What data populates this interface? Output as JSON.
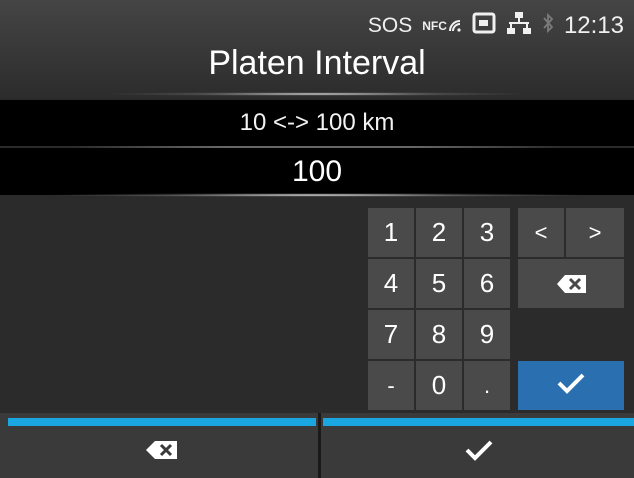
{
  "status": {
    "sos_text": "SOS",
    "nfc_text": "NFC",
    "time": "12:13",
    "icons": [
      "nfc-icon",
      "card-icon",
      "network-icon",
      "bluetooth-icon"
    ]
  },
  "header": {
    "title": "Platen Interval"
  },
  "range": {
    "text": "10 <-> 100 km"
  },
  "input": {
    "value": "100"
  },
  "keypad": {
    "keys": [
      "1",
      "2",
      "3",
      "4",
      "5",
      "6",
      "7",
      "8",
      "9",
      "-",
      "0",
      "."
    ],
    "left_arrow": "<",
    "right_arrow": ">",
    "backspace_icon": "backspace-icon",
    "ok_icon": "check-icon"
  },
  "footer": {
    "left_icon": "backspace-icon",
    "right_icon": "check-icon"
  },
  "colors": {
    "accent": "#1aa6e0",
    "ok_key": "#2a6fb0",
    "key_bg": "#4a4a4a",
    "background": "#2a2a2a"
  }
}
